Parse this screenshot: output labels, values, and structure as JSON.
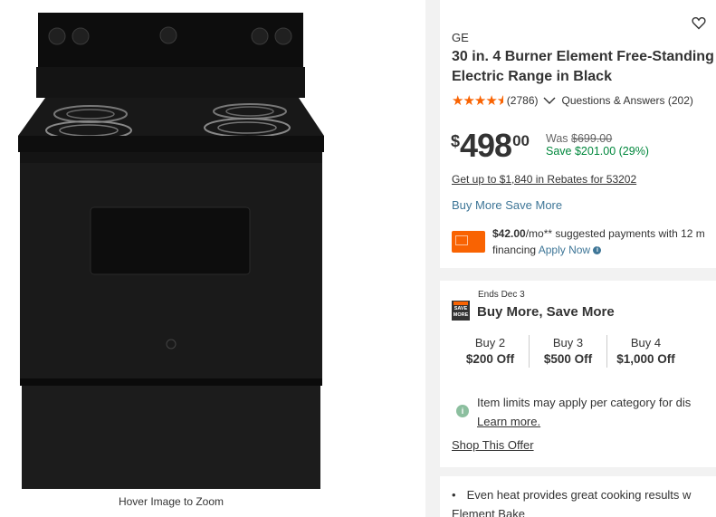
{
  "image": {
    "hover_label": "Hover Image to Zoom"
  },
  "product": {
    "brand": "GE",
    "title": "30 in. 4 Burner Element Free-Standing Electric Range in Black",
    "rating": 4.6,
    "review_count": "(2786)",
    "qa_label": "Questions & Answers (202)"
  },
  "pricing": {
    "currency": "$",
    "dollars": "498",
    "cents": "00",
    "was_label": "Was",
    "was_price": "$699.00",
    "save_text": "Save $201.00 (29%)",
    "rebate_link": "Get up to $1,840 in Rebates for 53202",
    "bmsm_link": "Buy More Save More",
    "financing_amount": "$42.00",
    "financing_suffix": "/mo**",
    "financing_text": " suggested payments with 12 m",
    "financing_line2": "financing ",
    "apply_now": "Apply Now"
  },
  "promo": {
    "ends": "Ends Dec 3",
    "badge": "SAVE MORE",
    "title": "Buy More, Save More",
    "tiers": [
      {
        "buy": "Buy 2",
        "off": "$200 Off"
      },
      {
        "buy": "Buy 3",
        "off": "$500 Off"
      },
      {
        "buy": "Buy 4",
        "off": "$1,000 Off"
      }
    ],
    "limit_text": "Item limits may apply per category for dis",
    "learn_more": "Learn more.",
    "shop_offer": "Shop This Offer"
  },
  "highlights": {
    "bullet1": "Even heat provides great cooking results w",
    "bullet1_line2": "Element Bake"
  },
  "colors": {
    "accent": "#f96302",
    "link": "#3e7697",
    "save": "#00873c"
  }
}
